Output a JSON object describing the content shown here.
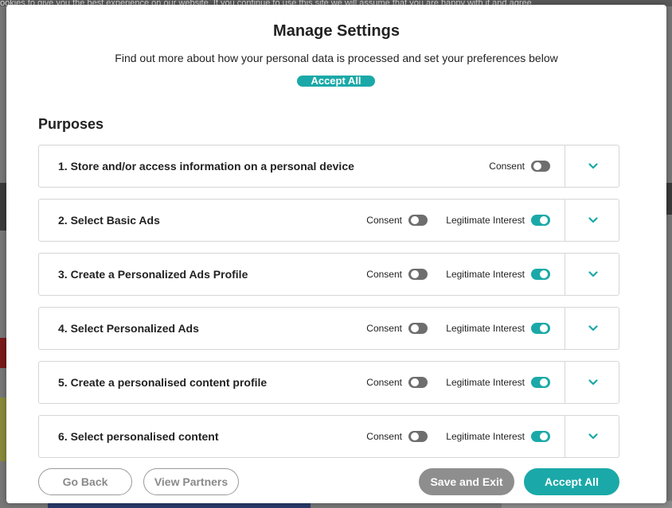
{
  "background": {
    "top_text": "ookies to give you the best experience on our website. If you continue to use this site we will assume that you are happy with it and agree"
  },
  "modal": {
    "title": "Manage Settings",
    "subtitle": "Find out more about how your personal data is processed and set your preferences below",
    "accept_all_top": "Accept All",
    "section_heading": "Purposes",
    "purposes": [
      {
        "title": "1. Store and/or access information on a personal device",
        "consent_label": "Consent",
        "consent_on": false,
        "legitimate_label": null,
        "legitimate_on": null
      },
      {
        "title": "2. Select Basic Ads",
        "consent_label": "Consent",
        "consent_on": false,
        "legitimate_label": "Legitimate Interest",
        "legitimate_on": true
      },
      {
        "title": "3. Create a Personalized Ads Profile",
        "consent_label": "Consent",
        "consent_on": false,
        "legitimate_label": "Legitimate Interest",
        "legitimate_on": true
      },
      {
        "title": "4. Select Personalized Ads",
        "consent_label": "Consent",
        "consent_on": false,
        "legitimate_label": "Legitimate Interest",
        "legitimate_on": true
      },
      {
        "title": "5. Create a personalised content profile",
        "consent_label": "Consent",
        "consent_on": false,
        "legitimate_label": "Legitimate Interest",
        "legitimate_on": true
      },
      {
        "title": "6. Select personalised content",
        "consent_label": "Consent",
        "consent_on": false,
        "legitimate_label": "Legitimate Interest",
        "legitimate_on": true
      }
    ],
    "footer": {
      "go_back": "Go Back",
      "view_partners": "View Partners",
      "save_exit": "Save and Exit",
      "accept_all": "Accept All"
    }
  },
  "colors": {
    "accent": "#1aa9a8",
    "toggle_off": "#6e6e6e",
    "save_button": "#8e8e8e"
  },
  "icons": {
    "expand": "chevron-down-icon"
  }
}
